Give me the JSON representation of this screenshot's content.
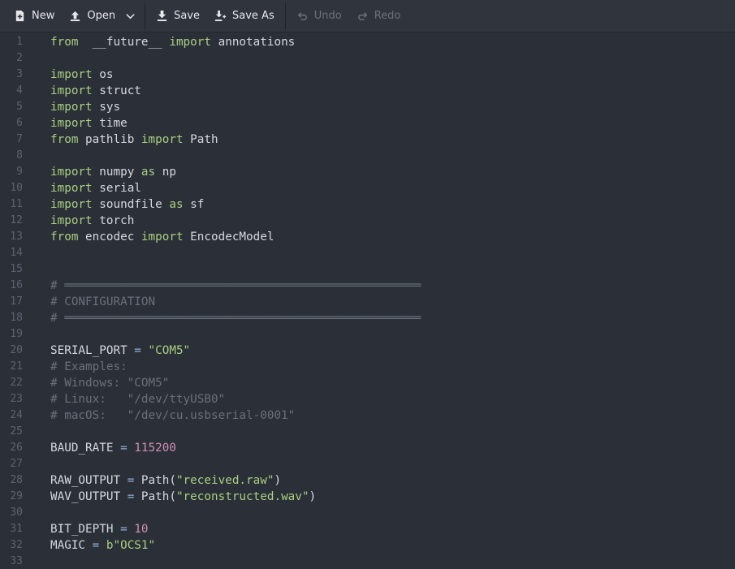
{
  "toolbar": {
    "new_label": "New",
    "open_label": "Open",
    "save_label": "Save",
    "save_as_label": "Save As",
    "undo_label": "Undo",
    "redo_label": "Redo"
  },
  "editor": {
    "lines": [
      {
        "n": "1",
        "t": [
          [
            "kw",
            "from"
          ],
          [
            "",
            "  __future__ "
          ],
          [
            "kw",
            "import"
          ],
          [
            "",
            " annotations"
          ]
        ]
      },
      {
        "n": "2",
        "t": []
      },
      {
        "n": "3",
        "t": [
          [
            "kw",
            "import"
          ],
          [
            "",
            " os"
          ]
        ]
      },
      {
        "n": "4",
        "t": [
          [
            "kw",
            "import"
          ],
          [
            "",
            " struct"
          ]
        ]
      },
      {
        "n": "5",
        "t": [
          [
            "kw",
            "import"
          ],
          [
            "",
            " sys"
          ]
        ]
      },
      {
        "n": "6",
        "t": [
          [
            "kw",
            "import"
          ],
          [
            "",
            " time"
          ]
        ]
      },
      {
        "n": "7",
        "t": [
          [
            "kw",
            "from"
          ],
          [
            "",
            " pathlib "
          ],
          [
            "kw",
            "import"
          ],
          [
            "",
            " Path"
          ]
        ]
      },
      {
        "n": "8",
        "t": []
      },
      {
        "n": "9",
        "t": [
          [
            "kw",
            "import"
          ],
          [
            "",
            " numpy "
          ],
          [
            "kw",
            "as"
          ],
          [
            "",
            " np"
          ]
        ]
      },
      {
        "n": "10",
        "t": [
          [
            "kw",
            "import"
          ],
          [
            "",
            " serial"
          ]
        ]
      },
      {
        "n": "11",
        "t": [
          [
            "kw",
            "import"
          ],
          [
            "",
            " soundfile "
          ],
          [
            "kw",
            "as"
          ],
          [
            "",
            " sf"
          ]
        ]
      },
      {
        "n": "12",
        "t": [
          [
            "kw",
            "import"
          ],
          [
            "",
            " torch"
          ]
        ]
      },
      {
        "n": "13",
        "t": [
          [
            "kw",
            "from"
          ],
          [
            "",
            " encodec "
          ],
          [
            "kw",
            "import"
          ],
          [
            "",
            " EncodecModel"
          ]
        ]
      },
      {
        "n": "14",
        "t": []
      },
      {
        "n": "15",
        "t": []
      },
      {
        "n": "16",
        "t": [
          [
            "cm",
            "# ═══════════════════════════════════════════════════"
          ]
        ]
      },
      {
        "n": "17",
        "t": [
          [
            "cm",
            "# CONFIGURATION"
          ]
        ]
      },
      {
        "n": "18",
        "t": [
          [
            "cm",
            "# ═══════════════════════════════════════════════════"
          ]
        ]
      },
      {
        "n": "19",
        "t": []
      },
      {
        "n": "20",
        "t": [
          [
            "",
            "SERIAL_PORT "
          ],
          [
            "op",
            "="
          ],
          [
            "",
            " "
          ],
          [
            "str",
            "\"COM5\""
          ]
        ]
      },
      {
        "n": "21",
        "t": [
          [
            "cm",
            "# Examples:"
          ]
        ]
      },
      {
        "n": "22",
        "t": [
          [
            "cm",
            "# Windows: \"COM5\""
          ]
        ]
      },
      {
        "n": "23",
        "t": [
          [
            "cm",
            "# Linux:   \"/dev/ttyUSB0\""
          ]
        ]
      },
      {
        "n": "24",
        "t": [
          [
            "cm",
            "# macOS:   \"/dev/cu.usbserial-0001\""
          ]
        ]
      },
      {
        "n": "25",
        "t": []
      },
      {
        "n": "26",
        "t": [
          [
            "",
            "BAUD_RATE "
          ],
          [
            "op",
            "="
          ],
          [
            "",
            " "
          ],
          [
            "num",
            "115200"
          ]
        ]
      },
      {
        "n": "27",
        "t": []
      },
      {
        "n": "28",
        "t": [
          [
            "",
            "RAW_OUTPUT "
          ],
          [
            "op",
            "="
          ],
          [
            "",
            " Path("
          ],
          [
            "str",
            "\"received.raw\""
          ],
          [
            "",
            ")"
          ]
        ]
      },
      {
        "n": "29",
        "t": [
          [
            "",
            "WAV_OUTPUT "
          ],
          [
            "op",
            "="
          ],
          [
            "",
            " Path("
          ],
          [
            "str",
            "\"reconstructed.wav\""
          ],
          [
            "",
            ")"
          ]
        ]
      },
      {
        "n": "30",
        "t": []
      },
      {
        "n": "31",
        "t": [
          [
            "",
            "BIT_DEPTH "
          ],
          [
            "op",
            "="
          ],
          [
            "",
            " "
          ],
          [
            "num",
            "10"
          ]
        ]
      },
      {
        "n": "32",
        "t": [
          [
            "",
            "MAGIC "
          ],
          [
            "op",
            "="
          ],
          [
            "",
            " "
          ],
          [
            "str",
            "b\"OCS1\""
          ]
        ]
      },
      {
        "n": "33",
        "t": []
      }
    ]
  }
}
